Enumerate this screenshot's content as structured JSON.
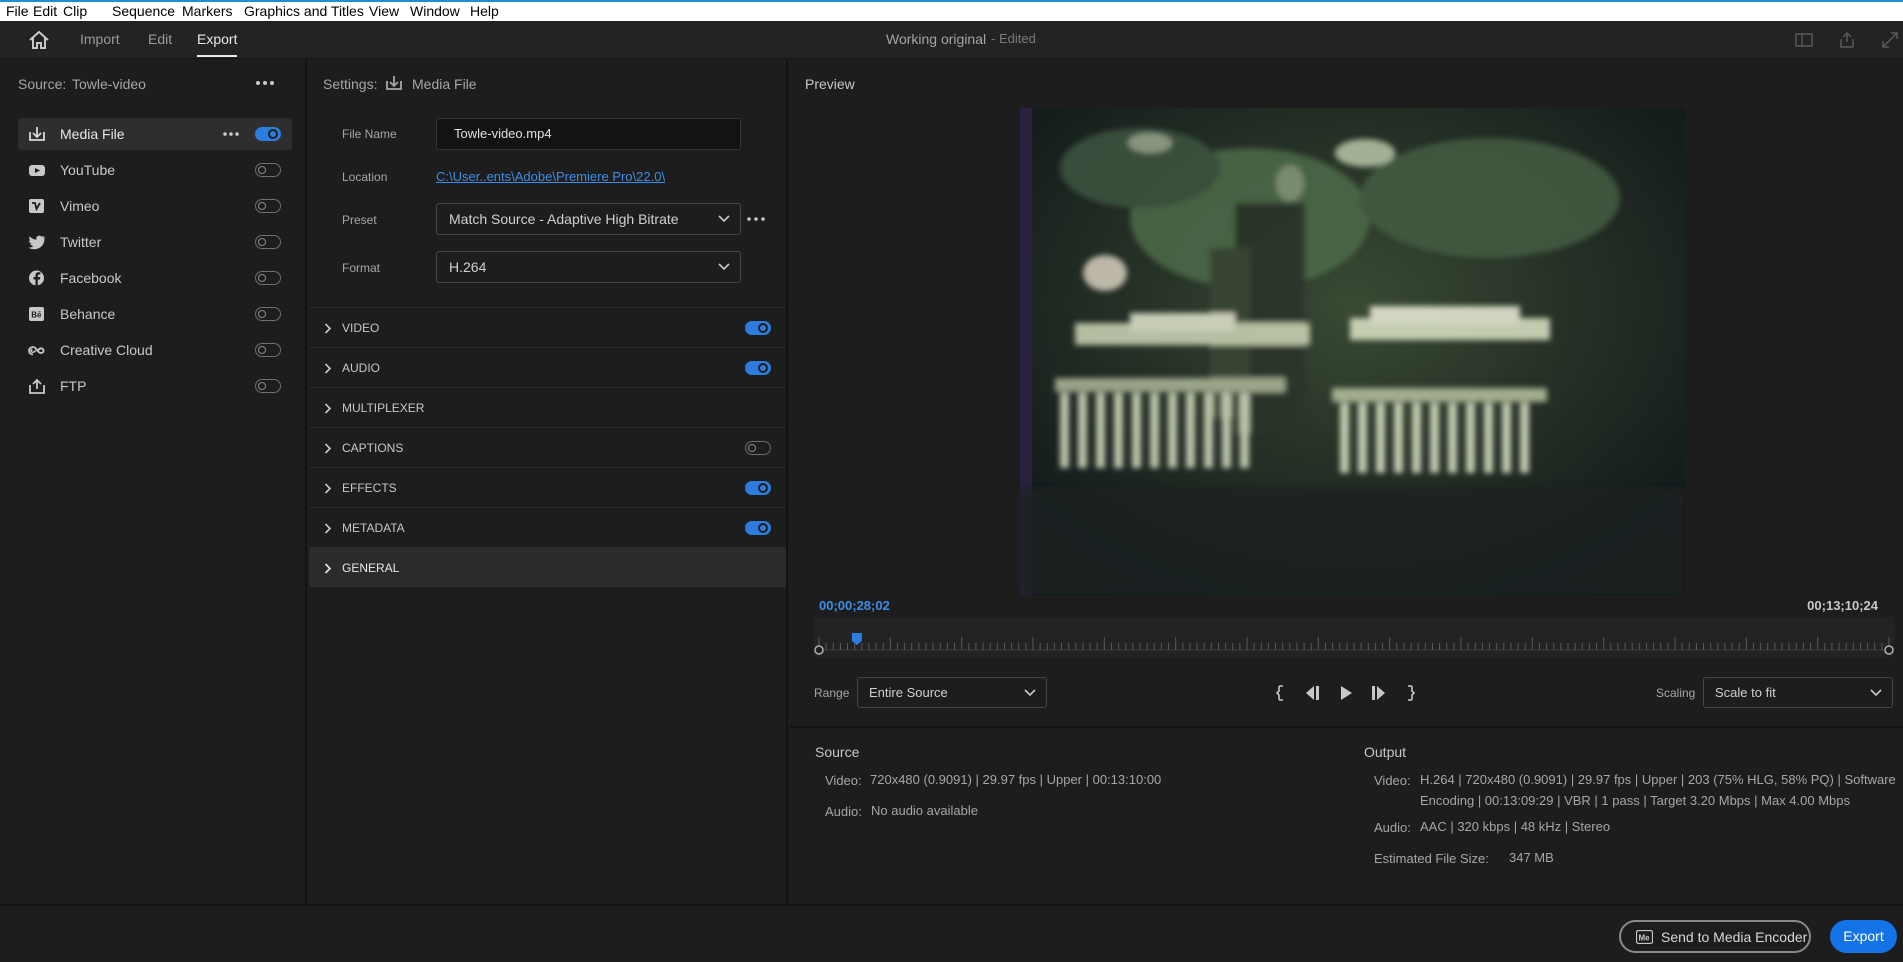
{
  "menubar": {
    "items": [
      "File",
      "Edit",
      "Clip",
      "Sequence",
      "Markers",
      "Graphics and Titles",
      "View",
      "Window",
      "Help"
    ]
  },
  "topbar": {
    "tabs": [
      "Import",
      "Edit",
      "Export"
    ],
    "active_tab": "Export",
    "title": "Working original",
    "status": "- Edited",
    "icons": [
      "home-icon",
      "panel-icon",
      "share-icon",
      "fullscreen-icon"
    ]
  },
  "source": {
    "label": "Source:",
    "value": "Towle-video"
  },
  "destinations": [
    {
      "label": "Media File",
      "icon": "download-icon",
      "enabled": true,
      "active": true
    },
    {
      "label": "YouTube",
      "icon": "youtube-icon",
      "enabled": false
    },
    {
      "label": "Vimeo",
      "icon": "vimeo-icon",
      "enabled": false
    },
    {
      "label": "Twitter",
      "icon": "twitter-icon",
      "enabled": false
    },
    {
      "label": "Facebook",
      "icon": "facebook-icon",
      "enabled": false
    },
    {
      "label": "Behance",
      "icon": "behance-icon",
      "enabled": false
    },
    {
      "label": "Creative Cloud",
      "icon": "creative-cloud-icon",
      "enabled": false
    },
    {
      "label": "FTP",
      "icon": "ftp-upload-icon",
      "enabled": false
    }
  ],
  "settings": {
    "label": "Settings:",
    "value": "Media File",
    "file_name_label": "File Name",
    "file_name": "Towle-video.mp4",
    "location_label": "Location",
    "location": "C:\\User..ents\\Adobe\\Premiere Pro\\22.0\\",
    "preset_label": "Preset",
    "preset": "Match Source - Adaptive High Bitrate",
    "format_label": "Format",
    "format": "H.264",
    "sections": [
      {
        "label": "VIDEO",
        "toggle": "on"
      },
      {
        "label": "AUDIO",
        "toggle": "on"
      },
      {
        "label": "MULTIPLEXER",
        "toggle": "none"
      },
      {
        "label": "CAPTIONS",
        "toggle": "off"
      },
      {
        "label": "EFFECTS",
        "toggle": "on"
      },
      {
        "label": "METADATA",
        "toggle": "on"
      },
      {
        "label": "GENERAL",
        "toggle": "none"
      }
    ]
  },
  "preview": {
    "label": "Preview",
    "timecode_current": "00;00;28;02",
    "timecode_duration": "00;13;10;24",
    "playhead_fraction": 0.0354,
    "range_label": "Range",
    "range_value": "Entire Source",
    "scaling_label": "Scaling",
    "scaling_value": "Scale to fit",
    "transport_icons": [
      "mark-in-icon",
      "step-back-icon",
      "play-icon",
      "step-forward-icon",
      "mark-out-icon"
    ]
  },
  "source_info": {
    "heading": "Source",
    "video_label": "Video:",
    "video_value": "720x480 (0.9091)  |  29.97 fps  |  Upper  |  00:13:10:00",
    "audio_label": "Audio:",
    "audio_value": "No audio available"
  },
  "output_info": {
    "heading": "Output",
    "video_label": "Video:",
    "video_line1": "H.264  |  720x480 (0.9091)  |  29.97 fps  |  Upper  |  203 (75% HLG, 58% PQ)  |  Software",
    "video_line2": "Encoding  |  00:13:09:29  |  VBR  |  1 pass  |  Target 3.20 Mbps  |  Max 4.00 Mbps",
    "audio_label": "Audio:",
    "audio_value": "AAC  |  320 kbps  |  48 kHz  |  Stereo",
    "size_label": "Estimated File Size:",
    "size_value": "347 MB"
  },
  "footer": {
    "send_label": "Send to Media Encoder",
    "export_label": "Export"
  },
  "colors": {
    "accent": "#1473e6",
    "link": "#3d8ee8",
    "toggle_on": "#2d7de0",
    "background": "#1d1d1d"
  }
}
